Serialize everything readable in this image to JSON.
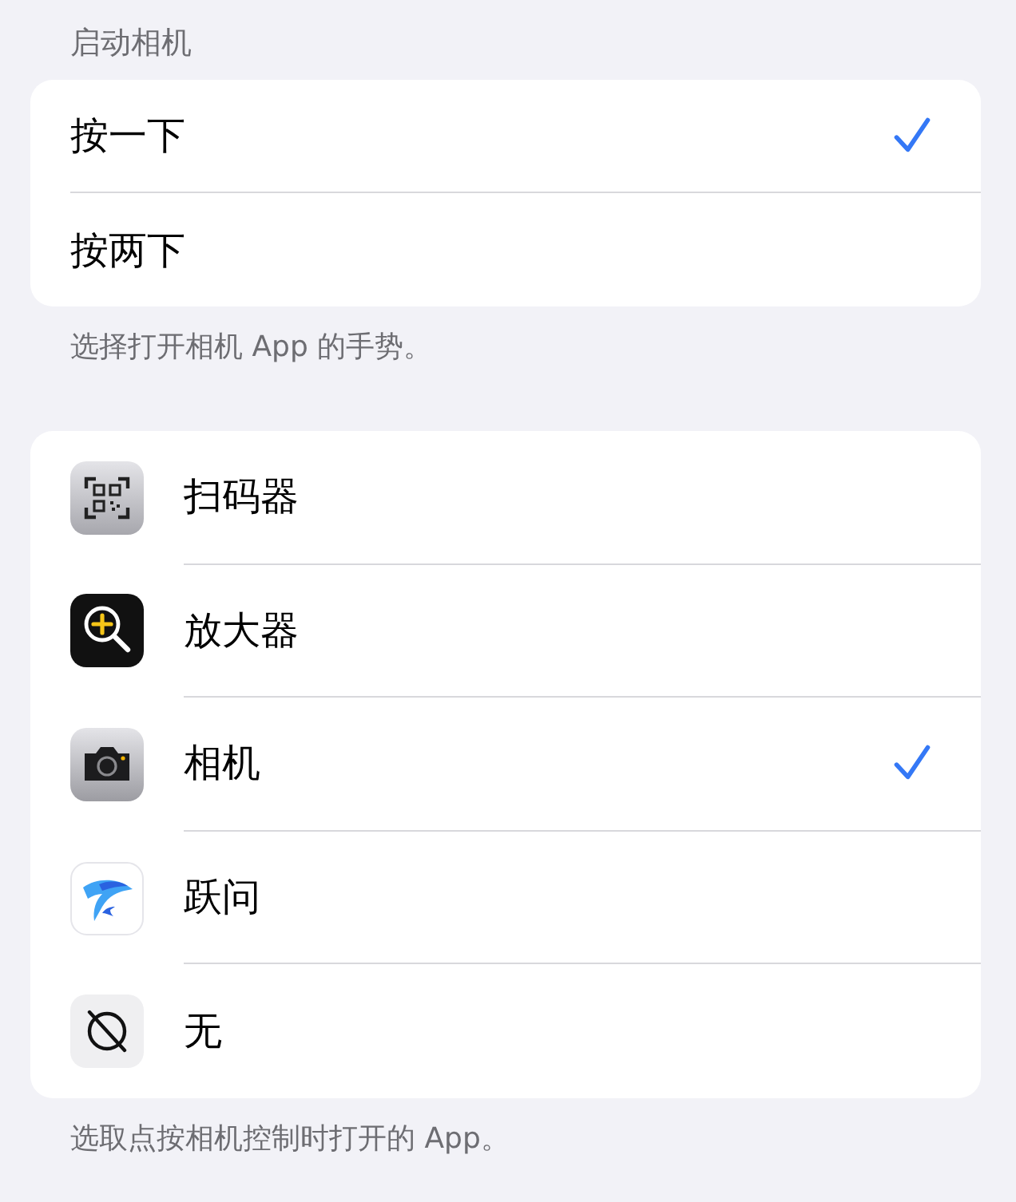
{
  "section_header": "启动相机",
  "gesture_options": [
    {
      "label": "按一下",
      "selected": true
    },
    {
      "label": "按两下",
      "selected": false
    }
  ],
  "gesture_footer": "选择打开相机 App 的手势。",
  "app_options": [
    {
      "label": "扫码器",
      "kind": "qr",
      "selected": false
    },
    {
      "label": "放大器",
      "kind": "magnifier",
      "selected": false
    },
    {
      "label": "相机",
      "kind": "camera",
      "selected": true
    },
    {
      "label": "跃问",
      "kind": "dolphin",
      "selected": false
    },
    {
      "label": "无",
      "kind": "none",
      "selected": false
    }
  ],
  "app_footer": "选取点按相机控制时打开的 App。"
}
